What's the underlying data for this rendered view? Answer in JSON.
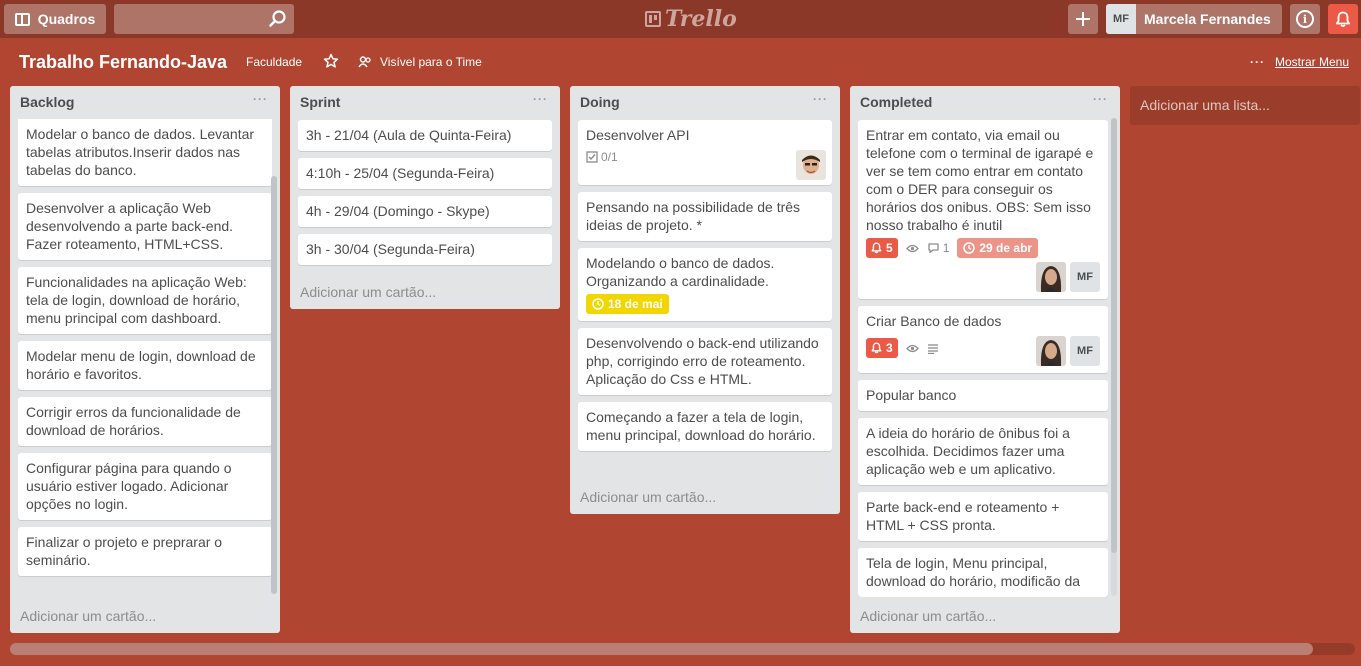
{
  "header": {
    "boards_label": "Quadros",
    "search_value": "",
    "logo_text": "Trello",
    "user_initials": "MF",
    "user_name": "Marcela Fernandes",
    "info_label": "i"
  },
  "board": {
    "title": "Trabalho Fernando-Java",
    "team": "Faculdade",
    "visibility": "Visível para o Time",
    "menu_label": "Mostrar Menu"
  },
  "colors": {
    "background": "#b04632",
    "label_red": "#eb5a46",
    "label_yellow": "#f2d600",
    "due_pink": "#ec9488"
  },
  "lists": [
    {
      "name": "Backlog",
      "add_card": "Adicionar um cartão...",
      "cards": [
        {
          "text": "Modelar o banco de dados. Levantar tabelas atributos.Inserir dados nas tabelas do banco."
        },
        {
          "text": "Desenvolver a aplicação Web desenvolvendo a parte back-end. Fazer roteamento, HTML+CSS."
        },
        {
          "text": "Funcionalidades na aplicação Web: tela de login, download de horário, menu principal com dashboard."
        },
        {
          "text": "Modelar menu de login, download de horário e favoritos."
        },
        {
          "text": "Corrigir erros da funcionalidade de download de horários."
        },
        {
          "text": "Configurar página para quando o usuário estiver logado. Adicionar opções no login."
        },
        {
          "text": "Finalizar o projeto e preprarar o seminário."
        }
      ]
    },
    {
      "name": "Sprint",
      "add_card": "Adicionar um cartão...",
      "cards": [
        {
          "text": "3h - 21/04 (Aula de Quinta-Feira)"
        },
        {
          "text": "4:10h - 25/04 (Segunda-Feira)"
        },
        {
          "text": "4h - 29/04 (Domingo - Skype)"
        },
        {
          "text": "3h - 30/04 (Segunda-Feira)"
        }
      ]
    },
    {
      "name": "Doing",
      "add_card": "Adicionar um cartão...",
      "cards": [
        {
          "text": "Desenvolver API",
          "checklist": "0/1"
        },
        {
          "text": "Pensando na possibilidade de três ideias de projeto. *"
        },
        {
          "text": "Modelando o banco de dados. Organizando a cardinalidade.",
          "due": "18 de mai"
        },
        {
          "text": "Desenvolvendo o back-end utilizando php, corrigindo erro de roteamento. Aplicação do Css e HTML."
        },
        {
          "text": "Começando a fazer a tela de login, menu principal, download do horário."
        }
      ]
    },
    {
      "name": "Completed",
      "add_card": "Adicionar um cartão...",
      "cards": [
        {
          "text": "Entrar em contato, via email ou telefone com o terminal de igarapé e ver se tem como entrar em contato com o DER para conseguir os horários dos onibus. OBS: Sem isso nosso trabalho é inutil",
          "alerts": "5",
          "comments": "1",
          "due": "29 de abr",
          "member_initials": "MF"
        },
        {
          "text": "Criar Banco de dados",
          "alerts": "3",
          "member_initials": "MF"
        },
        {
          "text": "Popular banco"
        },
        {
          "text": "A ideia do horário de ônibus foi a escolhida. Decidimos fazer uma aplicação web e um aplicativo."
        },
        {
          "text": "Parte back-end e roteamento + HTML + CSS pronta."
        },
        {
          "text": "Tela de login, Menu principal, download do horário, modificão da"
        }
      ]
    }
  ],
  "add_list": "Adicionar uma lista..."
}
